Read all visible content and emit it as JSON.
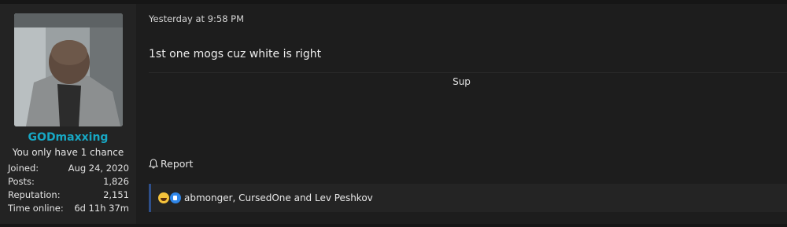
{
  "user": {
    "username": "GODmaxxing",
    "title": "You only have 1 chance",
    "stats": [
      {
        "label": "Joined:",
        "value": "Aug 24, 2020"
      },
      {
        "label": "Posts:",
        "value": "1,826"
      },
      {
        "label": "Reputation:",
        "value": "2,151"
      },
      {
        "label": "Time online:",
        "value": "6d 11h 37m"
      }
    ],
    "username_color": "#17a7c4"
  },
  "post": {
    "date": "Yesterday at 9:58 PM",
    "text": "1st one mogs cuz white is right",
    "signature": "Sup",
    "report_label": "Report",
    "reactions": {
      "icons": [
        "laughing-face-icon",
        "thumbs-up-icon"
      ],
      "text": "abmonger, CursedOne and Lev Peshkov"
    }
  }
}
